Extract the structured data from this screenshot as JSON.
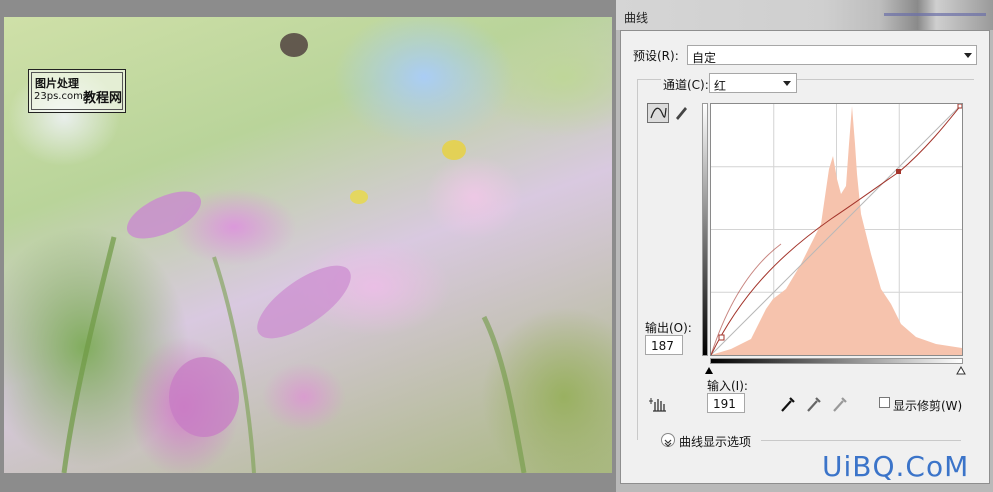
{
  "watermark": {
    "line1": "图片处理",
    "line2": "23ps.com",
    "line2b": "教程网"
  },
  "dialog": {
    "title": "曲线",
    "preset_label": "预设(R):",
    "preset_value": "自定",
    "channel_label": "通道(C):",
    "channel_value": "红",
    "output_label": "输出(O):",
    "output_value": "187",
    "input_label": "输入(I):",
    "input_value": "191",
    "show_clipping_label": "显示修剪(W)",
    "curve_options_label": "曲线显示选项"
  },
  "brand": {
    "text": "UiBQ.CoM"
  },
  "colors": {
    "histogram": "#f6c3ad",
    "curve": "#a3342b",
    "brand": "#3b74c9"
  }
}
